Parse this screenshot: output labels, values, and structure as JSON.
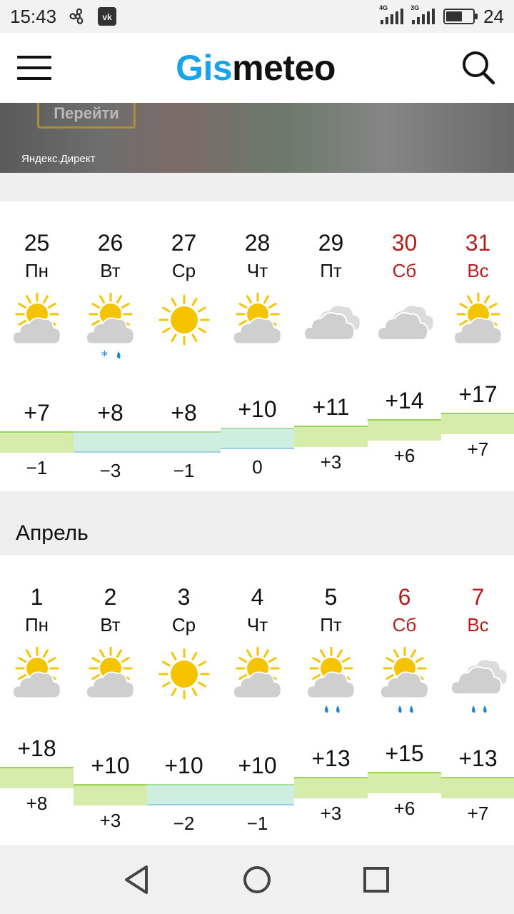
{
  "status": {
    "time": "15:43",
    "net1": "4G",
    "net2": "3G",
    "battery": "24",
    "battery_level": 0.6
  },
  "header": {
    "logo_part1": "Gis",
    "logo_part2": "meteo"
  },
  "ad": {
    "button": "Перейти",
    "label": "Яндекс.Директ"
  },
  "weeks": [
    {
      "days": [
        {
          "date": "25",
          "dow": "Пн",
          "weekend": false,
          "icon": "sun-cloud-icon",
          "precip": "",
          "max": "+7",
          "min": "−1"
        },
        {
          "date": "26",
          "dow": "Вт",
          "weekend": false,
          "icon": "sun-cloud-icon",
          "precip": "snow-rain",
          "max": "+8",
          "min": "−3"
        },
        {
          "date": "27",
          "dow": "Ср",
          "weekend": false,
          "icon": "sun-icon",
          "precip": "",
          "max": "+8",
          "min": "−1"
        },
        {
          "date": "28",
          "dow": "Чт",
          "weekend": false,
          "icon": "sun-cloud-icon",
          "precip": "",
          "max": "+10",
          "min": "0"
        },
        {
          "date": "29",
          "dow": "Пт",
          "weekend": false,
          "icon": "cloud-icon",
          "precip": "",
          "max": "+11",
          "min": "+3"
        },
        {
          "date": "30",
          "dow": "Сб",
          "weekend": true,
          "icon": "cloud-icon",
          "precip": "",
          "max": "+14",
          "min": "+6"
        },
        {
          "date": "31",
          "dow": "Вс",
          "weekend": true,
          "icon": "sun-cloud-icon",
          "precip": "",
          "max": "+17",
          "min": "+7"
        }
      ]
    },
    {
      "month": "Апрель",
      "days": [
        {
          "date": "1",
          "dow": "Пн",
          "weekend": false,
          "icon": "sun-cloud-icon",
          "precip": "",
          "max": "+18",
          "min": "+8"
        },
        {
          "date": "2",
          "dow": "Вт",
          "weekend": false,
          "icon": "sun-cloud-icon",
          "precip": "",
          "max": "+10",
          "min": "+3"
        },
        {
          "date": "3",
          "dow": "Ср",
          "weekend": false,
          "icon": "sun-icon",
          "precip": "",
          "max": "+10",
          "min": "−2"
        },
        {
          "date": "4",
          "dow": "Чт",
          "weekend": false,
          "icon": "sun-cloud-icon",
          "precip": "",
          "max": "+10",
          "min": "−1"
        },
        {
          "date": "5",
          "dow": "Пт",
          "weekend": false,
          "icon": "sun-cloud-icon",
          "precip": "rain",
          "max": "+13",
          "min": "+3"
        },
        {
          "date": "6",
          "dow": "Сб",
          "weekend": true,
          "icon": "sun-cloud-icon",
          "precip": "rain",
          "max": "+15",
          "min": "+6"
        },
        {
          "date": "7",
          "dow": "Вс",
          "weekend": true,
          "icon": "cloud-icon",
          "precip": "rain",
          "max": "+13",
          "min": "+7"
        }
      ]
    }
  ],
  "colors": {
    "brand": "#1aa3e8",
    "weekend": "#b71c1c",
    "warm_bar": "#d6ecaa",
    "cold_bar": "#cdeee0"
  }
}
